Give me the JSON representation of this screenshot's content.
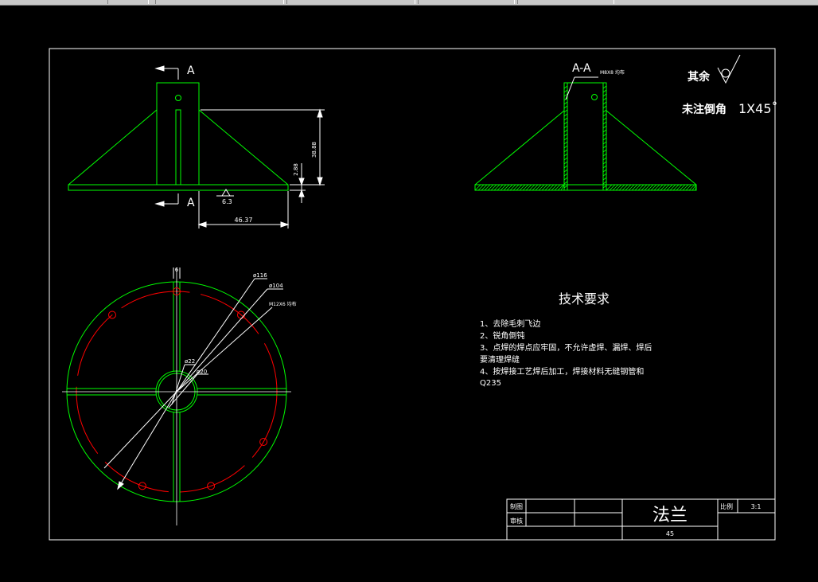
{
  "drawing": {
    "front_view": {
      "section_label_top": "A",
      "section_label_bottom": "A",
      "dim_height": "38.88",
      "dim_thickness": "2.88",
      "dim_width": "46.37",
      "roughness": "6.3"
    },
    "section_view": {
      "label": "A-A",
      "thread_note": "M8X8 均布"
    },
    "notes_top_right": {
      "rest_label": "其余",
      "chamfer_label": "未注倒角",
      "chamfer_value": "1X45˚"
    },
    "plan_view": {
      "slot_dim": "6",
      "dia_outer": "ø116",
      "dia_bolt_circle": "ø104",
      "hole_note": "M12X6 均布",
      "dia_hub_outer": "ø22",
      "dia_hub_inner": "ø20"
    },
    "tech_requirements": {
      "title": "技术要求",
      "lines": [
        "1、去除毛刺飞边",
        "2、锐角倒钝",
        "3、点焊的焊点应牢固，不允许虚焊、漏焊、焊后",
        "要清理焊缝",
        "4、按焊接工艺焊后加工，焊接材料无缝钢管和",
        "Q235"
      ]
    },
    "title_block": {
      "drawn_label": "制图",
      "checked_label": "审核",
      "part_name": "法兰",
      "scale_label": "比例",
      "scale_value": "3:1",
      "material": "45"
    }
  },
  "colors": {
    "background": "#000000",
    "outline": "#00ff00",
    "centerline": "#ff0000",
    "dimension": "#ffffff"
  }
}
